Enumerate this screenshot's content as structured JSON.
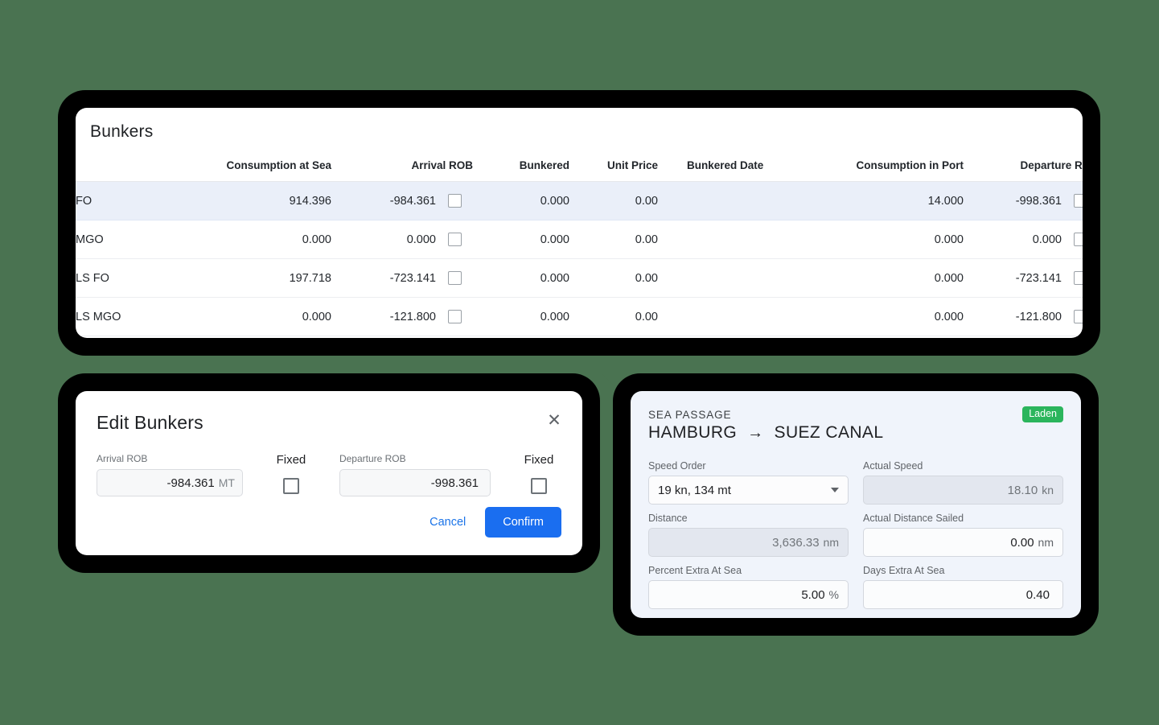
{
  "background_color": "#4a7351",
  "bunkers_card": {
    "title": "Bunkers",
    "columns": [
      {
        "key": "fuel",
        "label": ""
      },
      {
        "key": "consumption_at_sea",
        "label": "Consumption at Sea"
      },
      {
        "key": "arrival_rob",
        "label": "Arrival ROB"
      },
      {
        "key": "bunkered",
        "label": "Bunkered"
      },
      {
        "key": "unit_price",
        "label": "Unit Price"
      },
      {
        "key": "bunkered_date",
        "label": "Bunkered Date"
      },
      {
        "key": "consumption_in_port",
        "label": "Consumption in Port"
      },
      {
        "key": "departure_rob",
        "label": "Departure ROB"
      }
    ],
    "rows": [
      {
        "fuel": "FO",
        "consumption_at_sea": "914.396",
        "arrival_rob": "-984.361",
        "arrival_rob_fixed": false,
        "bunkered": "0.000",
        "unit_price": "0.00",
        "bunkered_date": "",
        "consumption_in_port": "14.000",
        "departure_rob": "-998.361",
        "departure_rob_fixed": false,
        "selected": true
      },
      {
        "fuel": "MGO",
        "consumption_at_sea": "0.000",
        "arrival_rob": "0.000",
        "arrival_rob_fixed": false,
        "bunkered": "0.000",
        "unit_price": "0.00",
        "bunkered_date": "",
        "consumption_in_port": "0.000",
        "departure_rob": "0.000",
        "departure_rob_fixed": false,
        "selected": false
      },
      {
        "fuel": "LS FO",
        "consumption_at_sea": "197.718",
        "arrival_rob": "-723.141",
        "arrival_rob_fixed": false,
        "bunkered": "0.000",
        "unit_price": "0.00",
        "bunkered_date": "",
        "consumption_in_port": "0.000",
        "departure_rob": "-723.141",
        "departure_rob_fixed": false,
        "selected": false
      },
      {
        "fuel": "LS MGO",
        "consumption_at_sea": "0.000",
        "arrival_rob": "-121.800",
        "arrival_rob_fixed": false,
        "bunkered": "0.000",
        "unit_price": "0.00",
        "bunkered_date": "",
        "consumption_in_port": "0.000",
        "departure_rob": "-121.800",
        "departure_rob_fixed": false,
        "selected": false
      }
    ],
    "row_edit_icon": "pencil-icon"
  },
  "edit_dialog": {
    "title": "Edit Bunkers",
    "close_icon": "close-icon",
    "arrival": {
      "label": "Arrival ROB",
      "value": "-984.361",
      "unit": "MT",
      "fixed_label": "Fixed",
      "fixed_checked": false
    },
    "departure": {
      "label": "Departure ROB",
      "value": "-998.361",
      "unit": "",
      "fixed_label": "Fixed",
      "fixed_checked": false
    },
    "cancel_label": "Cancel",
    "confirm_label": "Confirm",
    "confirm_color": "#1a6ef0",
    "cancel_color": "#1a73e8"
  },
  "sea_passage": {
    "kicker": "SEA PASSAGE",
    "origin": "HAMBURG",
    "arrow": "→",
    "destination": "SUEZ CANAL",
    "badge": {
      "label": "Laden",
      "color": "#2bb55c"
    },
    "fields": {
      "speed_order": {
        "label": "Speed Order",
        "value": "19 kn, 134 mt",
        "type": "select",
        "caret_icon": "chevron-down-icon"
      },
      "actual_speed": {
        "label": "Actual Speed",
        "value": "18.10",
        "unit": "kn",
        "disabled": true
      },
      "distance": {
        "label": "Distance",
        "value": "3,636.33",
        "unit": "nm",
        "disabled": true
      },
      "actual_distance_sailed": {
        "label": "Actual Distance Sailed",
        "value": "0.00",
        "unit": "nm",
        "disabled": false
      },
      "percent_extra_at_sea": {
        "label": "Percent Extra At Sea",
        "value": "5.00",
        "unit": "%",
        "disabled": false
      },
      "days_extra_at_sea": {
        "label": "Days Extra At Sea",
        "value": "0.40",
        "unit": "",
        "disabled": false
      }
    }
  }
}
